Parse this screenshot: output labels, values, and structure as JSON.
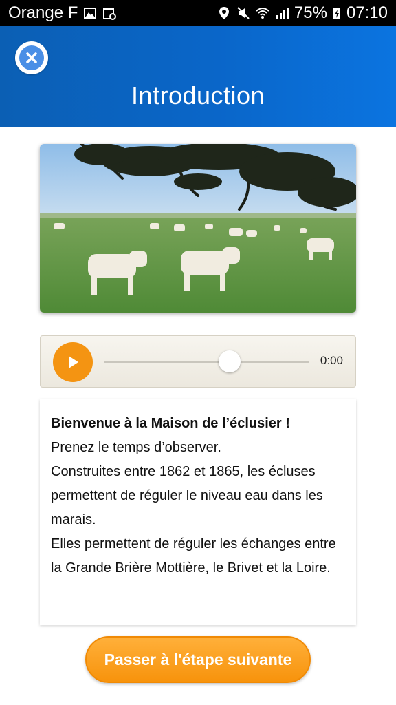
{
  "status_bar": {
    "carrier": "Orange F",
    "battery": "75%",
    "time": "07:10"
  },
  "header": {
    "title": "Introduction"
  },
  "player": {
    "time": "0:00",
    "progress": 0.61
  },
  "card": {
    "title": "Bienvenue à la Maison de l’éclusier  !",
    "paragraph_1": "Prenez le temps d’observer.",
    "paragraph_2": "Construites entre 1862 et 1865, les écluses permettent de réguler le niveau eau dans les marais.",
    "paragraph_3": "Elles permettent de réguler les échanges entre la Grande Brière Mottière, le Brivet et la Loire."
  },
  "footer": {
    "next_label": "Passer à l'étape suivante"
  },
  "colors": {
    "header_blue": "#0a66c9",
    "accent_orange": "#f49412"
  }
}
